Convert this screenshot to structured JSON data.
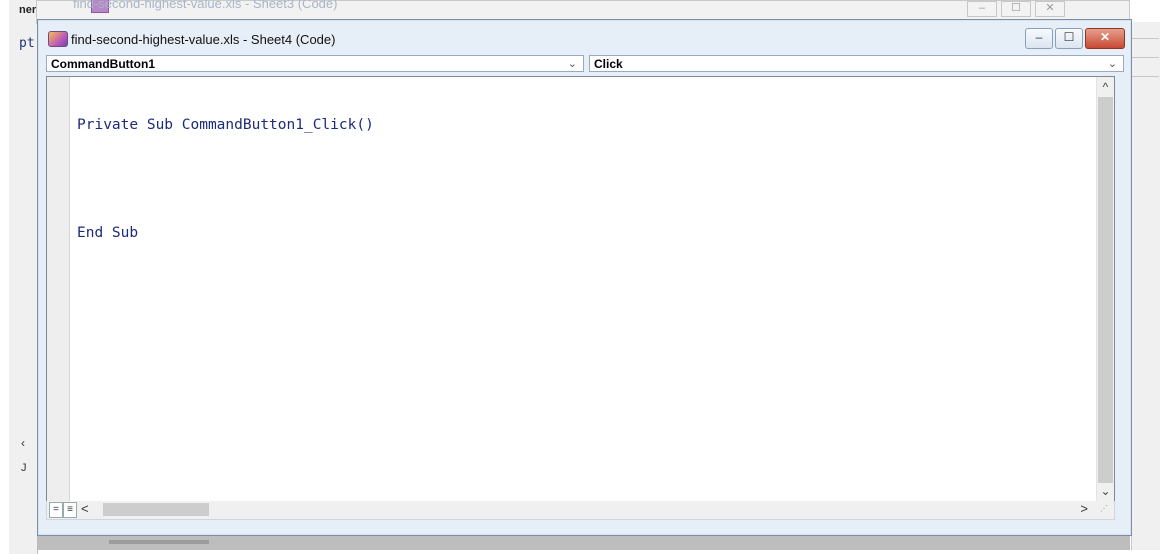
{
  "background_window": {
    "title": "find-second-highest-value.xls - Sheet3 (Code)",
    "controls": [
      "–",
      "☐",
      "✕"
    ]
  },
  "left_fragments": {
    "top_label": "nera",
    "code_fragment": "pt",
    "marker1": "‹",
    "marker2": "J"
  },
  "window": {
    "title": "find-second-highest-value.xls - Sheet4 (Code)",
    "controls": {
      "minimize": "–",
      "maximize": "☐",
      "close": "✕"
    }
  },
  "object_combo": {
    "value": "CommandButton1",
    "arrow": "⌄"
  },
  "procedure_combo": {
    "value": "Click",
    "arrow": "⌄"
  },
  "code_lines": {
    "line1": "Private Sub CommandButton1_Click()",
    "line2": "End Sub"
  },
  "scroll": {
    "up": "^",
    "down": "⌄",
    "left": "<",
    "right": ">"
  },
  "view_buttons": {
    "procedure_view": "=",
    "full_module_view": "≡"
  },
  "colors": {
    "code_text": "#1c2b7a",
    "close_button": "#c74a33",
    "window_frame": "#e6eef7"
  }
}
